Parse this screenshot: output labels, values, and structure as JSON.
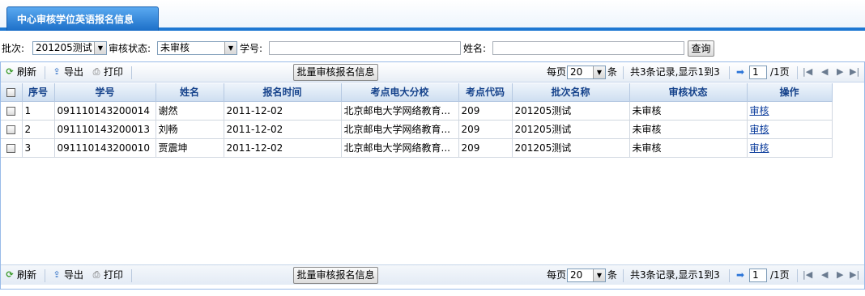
{
  "tab": {
    "title": "中心审核学位英语报名信息"
  },
  "filters": {
    "batch_label": "批次:",
    "batch_value": "201205测试",
    "status_label": "审核状态:",
    "status_value": "未审核",
    "student_no_label": "学号:",
    "student_no_value": "",
    "name_label": "姓名:",
    "name_value": "",
    "query_button": "查询"
  },
  "toolbar": {
    "refresh": "刷新",
    "export": "导出",
    "print": "打印",
    "batch_review": "批量审核报名信息",
    "per_page_prefix": "每页",
    "per_page_value": "20",
    "per_page_suffix": "条",
    "records_info": "共3条记录,显示1到3",
    "page_value": "1",
    "page_total": "/1页"
  },
  "table": {
    "columns": [
      "序号",
      "学号",
      "姓名",
      "报名时间",
      "考点电大分校",
      "考点代码",
      "批次名称",
      "审核状态",
      "操作"
    ],
    "rows": [
      {
        "seq": "1",
        "student_no": "091110143200014",
        "name": "谢然",
        "time": "2011-12-02",
        "branch": "北京邮电大学网络教育...",
        "code": "209",
        "batch": "201205测试",
        "status": "未审核",
        "action": "审核"
      },
      {
        "seq": "2",
        "student_no": "091110143200013",
        "name": "刘畅",
        "time": "2011-12-02",
        "branch": "北京邮电大学网络教育...",
        "code": "209",
        "batch": "201205测试",
        "status": "未审核",
        "action": "审核"
      },
      {
        "seq": "3",
        "student_no": "091110143200010",
        "name": "贾震坤",
        "time": "2011-12-02",
        "branch": "北京邮电大学网络教育...",
        "code": "209",
        "batch": "201205测试",
        "status": "未审核",
        "action": "审核"
      }
    ]
  },
  "icons": [
    "refresh-icon",
    "export-icon",
    "print-icon",
    "go-page-icon",
    "first-page-icon",
    "prev-page-icon",
    "next-page-icon",
    "last-page-icon"
  ],
  "colors": {
    "accent": "#1e78d2",
    "header_text": "#15428b",
    "link": "#0b3c9c"
  }
}
